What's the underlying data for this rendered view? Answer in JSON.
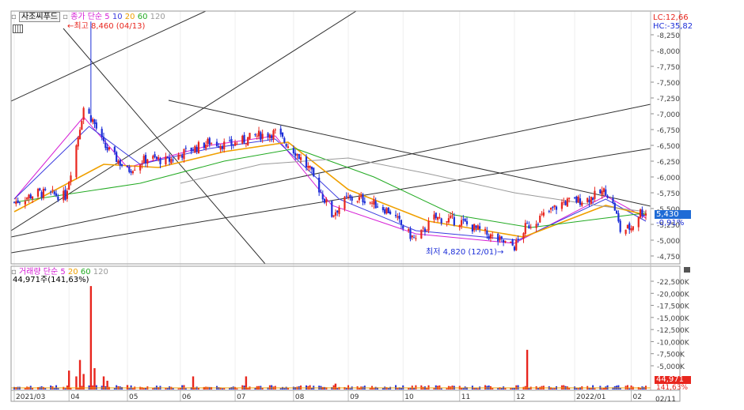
{
  "price_panel": {
    "title": "사조씨푸드",
    "ma_label": "종가 단순",
    "ma_periods": [
      "5",
      "10",
      "20",
      "60",
      "120"
    ],
    "ma_colors": [
      "#d61fd6",
      "#3a3adf",
      "#f0a000",
      "#22aa22",
      "#9a9a9a"
    ],
    "high_marker": "최고 8,460 (04/13)",
    "low_marker": "최저 4,820 (12/01)",
    "lc": "LC:12,66",
    "hc": "HC:-35,82",
    "current_price": "5,430",
    "current_change": "-0,91%"
  },
  "volume_panel": {
    "title": "거래량 단순",
    "ma_periods": [
      "5",
      "20",
      "60",
      "120"
    ],
    "ma_colors": [
      "#d61fd6",
      "#f0a000",
      "#22aa22",
      "#9a9a9a"
    ],
    "value_line": "44,971주(141,63%)",
    "current_volume": "44,971",
    "current_pct": "141,63%"
  },
  "x_axis": {
    "ticks": [
      "2021/03",
      "04",
      "05",
      "06",
      "07",
      "08",
      "09",
      "10",
      "11",
      "12",
      "2022/01",
      "02"
    ],
    "end_label": "02/11"
  },
  "footer": "",
  "colors": {
    "up": "#e8261e",
    "down": "#1d2fd8",
    "current_bg": "#1e6bd6",
    "current_vol_bg": "#e8261e"
  },
  "chart_data": [
    {
      "type": "candlestick",
      "title": "사조씨푸드",
      "y_ticks": [
        "8,250",
        "8,000",
        "7,750",
        "7,500",
        "7,250",
        "7,000",
        "6,750",
        "6,500",
        "6,250",
        "6,000",
        "5,750",
        "5,500",
        "5,250",
        "5,000",
        "4,750"
      ],
      "ylim": [
        4650,
        8500
      ],
      "x_range": [
        "2021-03-02",
        "2022-02-11"
      ],
      "high": {
        "value": 8460,
        "date": "04/13"
      },
      "low": {
        "value": 4820,
        "date": "12/01"
      },
      "last_close": 5430,
      "last_change_pct": -0.91,
      "close_path": [
        {
          "x": "2021-03-02",
          "y": 5600
        },
        {
          "x": "2021-03-15",
          "y": 5750
        },
        {
          "x": "2021-03-30",
          "y": 5700
        },
        {
          "x": "2021-04-05",
          "y": 6500
        },
        {
          "x": "2021-04-09",
          "y": 7100
        },
        {
          "x": "2021-04-14",
          "y": 6900
        },
        {
          "x": "2021-04-20",
          "y": 6500
        },
        {
          "x": "2021-05-03",
          "y": 6100
        },
        {
          "x": "2021-05-14",
          "y": 6300
        },
        {
          "x": "2021-05-25",
          "y": 6250
        },
        {
          "x": "2021-06-04",
          "y": 6400
        },
        {
          "x": "2021-06-17",
          "y": 6550
        },
        {
          "x": "2021-06-28",
          "y": 6500
        },
        {
          "x": "2021-07-12",
          "y": 6650
        },
        {
          "x": "2021-07-23",
          "y": 6700
        },
        {
          "x": "2021-08-03",
          "y": 6400
        },
        {
          "x": "2021-08-11",
          "y": 6100
        },
        {
          "x": "2021-08-18",
          "y": 5700
        },
        {
          "x": "2021-08-23",
          "y": 5400
        },
        {
          "x": "2021-08-31",
          "y": 5650
        },
        {
          "x": "2021-09-10",
          "y": 5650
        },
        {
          "x": "2021-09-24",
          "y": 5450
        },
        {
          "x": "2021-10-04",
          "y": 5100
        },
        {
          "x": "2021-10-08",
          "y": 5000
        },
        {
          "x": "2021-10-18",
          "y": 5350
        },
        {
          "x": "2021-11-01",
          "y": 5300
        },
        {
          "x": "2021-11-12",
          "y": 5150
        },
        {
          "x": "2021-11-22",
          "y": 5000
        },
        {
          "x": "2021-12-01",
          "y": 4900
        },
        {
          "x": "2021-12-07",
          "y": 5200
        },
        {
          "x": "2021-12-20",
          "y": 5450
        },
        {
          "x": "2021-12-28",
          "y": 5600
        },
        {
          "x": "2022-01-10",
          "y": 5650
        },
        {
          "x": "2022-01-20",
          "y": 5780
        },
        {
          "x": "2022-01-25",
          "y": 5500
        },
        {
          "x": "2022-01-28",
          "y": 5150
        },
        {
          "x": "2022-02-03",
          "y": 5200
        },
        {
          "x": "2022-02-08",
          "y": 5450
        },
        {
          "x": "2022-02-11",
          "y": 5430
        }
      ],
      "moving_averages": [
        {
          "name": "5",
          "values": [
            {
              "x": "2021-03-02",
              "y": 5650
            },
            {
              "x": "2021-04-09",
              "y": 6950
            },
            {
              "x": "2021-05-03",
              "y": 6150
            },
            {
              "x": "2021-06-17",
              "y": 6500
            },
            {
              "x": "2021-07-23",
              "y": 6650
            },
            {
              "x": "2021-08-23",
              "y": 5550
            },
            {
              "x": "2021-10-08",
              "y": 5100
            },
            {
              "x": "2021-12-01",
              "y": 4950
            },
            {
              "x": "2022-01-20",
              "y": 5700
            },
            {
              "x": "2022-02-11",
              "y": 5350
            }
          ]
        },
        {
          "name": "10",
          "values": [
            {
              "x": "2021-03-02",
              "y": 5650
            },
            {
              "x": "2021-04-12",
              "y": 6800
            },
            {
              "x": "2021-05-10",
              "y": 6200
            },
            {
              "x": "2021-06-17",
              "y": 6450
            },
            {
              "x": "2021-07-23",
              "y": 6600
            },
            {
              "x": "2021-08-27",
              "y": 5650
            },
            {
              "x": "2021-10-08",
              "y": 5150
            },
            {
              "x": "2021-12-03",
              "y": 5000
            },
            {
              "x": "2022-01-20",
              "y": 5650
            },
            {
              "x": "2022-02-11",
              "y": 5300
            }
          ]
        },
        {
          "name": "20",
          "values": [
            {
              "x": "2021-03-02",
              "y": 5450
            },
            {
              "x": "2021-04-20",
              "y": 6200
            },
            {
              "x": "2021-05-20",
              "y": 6150
            },
            {
              "x": "2021-06-25",
              "y": 6400
            },
            {
              "x": "2021-07-30",
              "y": 6550
            },
            {
              "x": "2021-09-01",
              "y": 5800
            },
            {
              "x": "2021-10-15",
              "y": 5300
            },
            {
              "x": "2021-12-06",
              "y": 5050
            },
            {
              "x": "2022-01-20",
              "y": 5550
            },
            {
              "x": "2022-02-11",
              "y": 5400
            }
          ]
        },
        {
          "name": "60",
          "values": [
            {
              "x": "2021-03-02",
              "y": 5600
            },
            {
              "x": "2021-05-10",
              "y": 5900
            },
            {
              "x": "2021-06-25",
              "y": 6250
            },
            {
              "x": "2021-08-03",
              "y": 6450
            },
            {
              "x": "2021-09-15",
              "y": 6000
            },
            {
              "x": "2021-10-29",
              "y": 5400
            },
            {
              "x": "2021-12-10",
              "y": 5200
            },
            {
              "x": "2022-01-20",
              "y": 5350
            },
            {
              "x": "2022-02-11",
              "y": 5430
            }
          ]
        },
        {
          "name": "120",
          "values": [
            {
              "x": "2021-06-01",
              "y": 5900
            },
            {
              "x": "2021-07-15",
              "y": 6200
            },
            {
              "x": "2021-09-01",
              "y": 6300
            },
            {
              "x": "2021-10-15",
              "y": 6050
            },
            {
              "x": "2021-12-01",
              "y": 5750
            },
            {
              "x": "2022-01-15",
              "y": 5550
            },
            {
              "x": "2022-02-11",
              "y": 5450
            }
          ]
        }
      ]
    },
    {
      "type": "bar",
      "title": "거래량",
      "y_ticks": [
        "22,500K",
        "20,000K",
        "17,500K",
        "15,000K",
        "12,500K",
        "10,000K",
        "7,500K",
        "5,000K"
      ],
      "ylim": [
        0,
        24000
      ],
      "unit": "K",
      "last_volume": 44971,
      "last_volume_pct": 141.63,
      "spikes": [
        {
          "x": "2021-04-01",
          "y": 4000
        },
        {
          "x": "2021-04-05",
          "y": 2800
        },
        {
          "x": "2021-04-07",
          "y": 6200
        },
        {
          "x": "2021-04-09",
          "y": 3300
        },
        {
          "x": "2021-04-13",
          "y": 21500
        },
        {
          "x": "2021-04-15",
          "y": 4500
        },
        {
          "x": "2021-04-20",
          "y": 2800
        },
        {
          "x": "2021-04-22",
          "y": 1900
        },
        {
          "x": "2021-05-03",
          "y": 1000
        },
        {
          "x": "2021-06-08",
          "y": 2800
        },
        {
          "x": "2021-06-14",
          "y": 600
        },
        {
          "x": "2021-07-07",
          "y": 2800
        },
        {
          "x": "2021-07-13",
          "y": 600
        },
        {
          "x": "2021-08-18",
          "y": 600
        },
        {
          "x": "2021-08-25",
          "y": 1300
        },
        {
          "x": "2021-10-06",
          "y": 200
        },
        {
          "x": "2021-12-08",
          "y": 8300
        },
        {
          "x": "2022-01-20",
          "y": 400
        },
        {
          "x": "2022-02-11",
          "y": 45
        }
      ]
    }
  ]
}
